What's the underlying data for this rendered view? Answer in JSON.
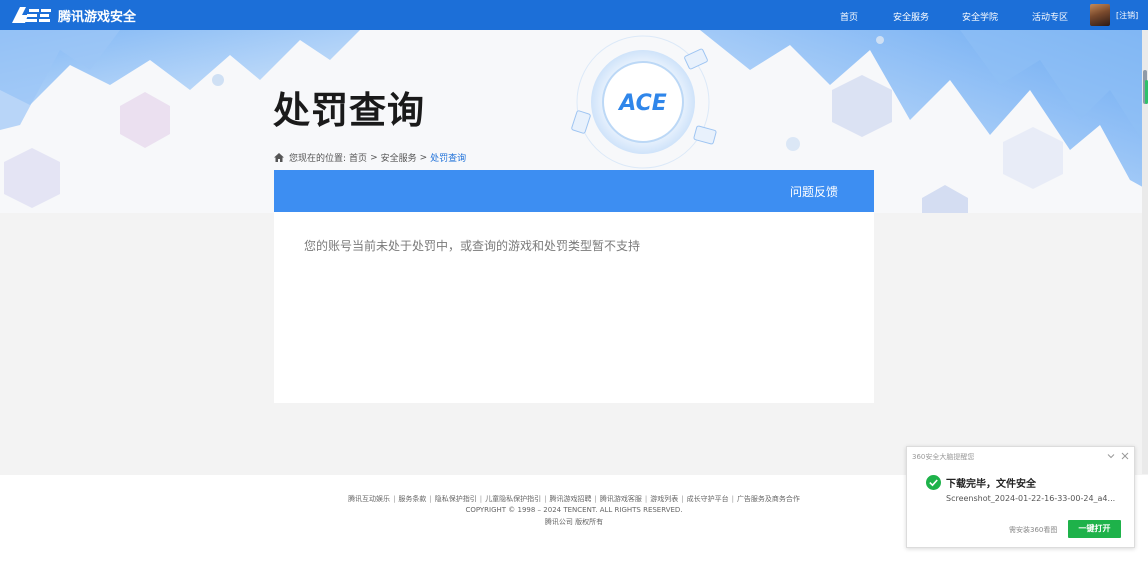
{
  "header": {
    "logo_text": "腾讯游戏安全",
    "nav": [
      {
        "label": "首页"
      },
      {
        "label": "安全服务"
      },
      {
        "label": "安全学院"
      },
      {
        "label": "活动专区"
      }
    ],
    "user_link": "[注销]"
  },
  "hero": {
    "title": "处罚查询",
    "emblem_text": "ACE"
  },
  "breadcrumb": {
    "prefix": "您现在的位置:",
    "items": [
      "首页",
      "安全服务"
    ],
    "separator": ">",
    "current": "处罚查询"
  },
  "panel": {
    "feedback": "问题反馈",
    "message": "您的账号当前未处于处罚中，或查询的游戏和处罚类型暂不支持"
  },
  "footer": {
    "links": [
      "腾讯互动娱乐",
      "服务条款",
      "隐私保护指引",
      "儿童隐私保护指引",
      "腾讯游戏招聘",
      "腾讯游戏客服",
      "游戏列表",
      "成长守护平台",
      "广告服务及商务合作"
    ],
    "link_separator": "|",
    "copyright": "COPYRIGHT © 1998 – 2024 TENCENT. ALL RIGHTS RESERVED.",
    "company": "腾讯公司 版权所有"
  },
  "popup": {
    "title": "360安全大脑提醒您",
    "status": "下载完毕，文件安全",
    "filename": "Screenshot_2024-01-22-16-33-00-24_a4...",
    "hint": "需安装360看图",
    "open_button": "一键打开"
  },
  "colors": {
    "brand_blue": "#1c6fd8",
    "panel_blue": "#3d8ef2",
    "success_green": "#1eb24a"
  }
}
